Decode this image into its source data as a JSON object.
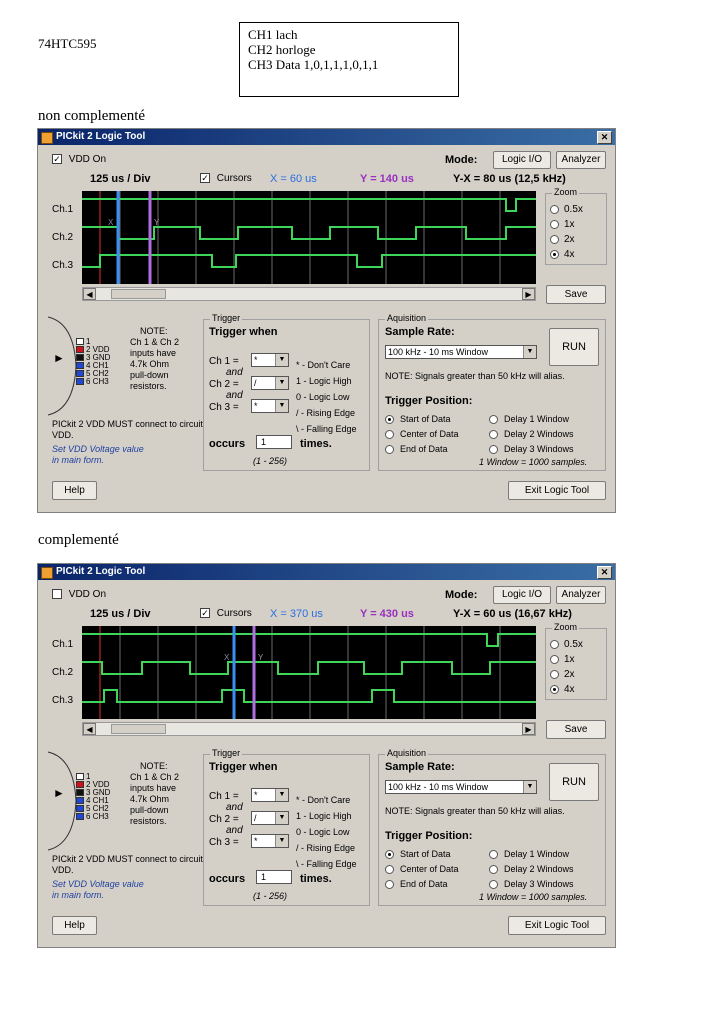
{
  "doc": {
    "ic_name": "74HTC595",
    "channels": [
      "CH1 lach",
      "CH2 horloge",
      "CH3 Data 1,0,1,1,1,0,1,1"
    ],
    "caption1": "non complementé",
    "caption2": "complementé"
  },
  "windows": [
    {
      "title": "PICkit 2 Logic Tool",
      "vdd_label": "VDD On",
      "vdd_checked": "✓",
      "mode_label": "Mode:",
      "mode_buttons": [
        "Logic I/O",
        "Analyzer"
      ],
      "time_div": "125 us / Div",
      "cursors_label": "Cursors",
      "cursors_checked": "✓",
      "x_readout": "X = 60 us",
      "y_readout": "Y = 140 us",
      "yx_readout": "Y-X = 80 us (12,5 kHz)",
      "channels": [
        "Ch.1",
        "Ch.2",
        "Ch.3"
      ],
      "zoom_title": "Zoom",
      "zoom_options": [
        "0.5x",
        "1x",
        "2x",
        "4x"
      ],
      "zoom_selected": "4x",
      "save_label": "Save",
      "pin_note": [
        "NOTE:",
        "Ch 1 & Ch 2",
        "inputs have",
        "4.7k Ohm",
        "pull-down",
        "resistors."
      ],
      "pins": [
        "1",
        "2 VDD",
        "3 GND",
        "4 CH1",
        "5 CH2",
        "6 CH3"
      ],
      "vdd_connect": "PICkit 2 VDD MUST connect to circuit VDD.",
      "vdd_set": [
        "Set VDD Voltage value",
        "in main form."
      ],
      "help_label": "Help",
      "trigger": {
        "group": "Trigger",
        "heading": "Trigger when",
        "ch1": "Ch 1 =",
        "ch2": "Ch 2 =",
        "ch3": "Ch 3 =",
        "and": "and",
        "ch1_val": "*",
        "ch2_val": "/",
        "ch3_val": "*",
        "legend": [
          "* - Don't Care",
          "1 - Logic High",
          "0 - Logic Low",
          "/ - Rising Edge",
          "\\ - Falling Edge"
        ],
        "occurs": "occurs",
        "occurs_val": "1",
        "times": "times.",
        "range": "(1 - 256)"
      },
      "acq": {
        "group": "Aquisition",
        "sample_rate": "Sample Rate:",
        "rate_val": "100 kHz - 10 ms Window",
        "run": "RUN",
        "alias_note": "NOTE: Signals greater than 50 kHz will alias.",
        "trig_pos": "Trigger Position:",
        "positions": [
          "Start of Data",
          "Center of Data",
          "End of Data",
          "Delay 1 Window",
          "Delay 2 Windows",
          "Delay 3 Windows"
        ],
        "position_selected": "Start of Data",
        "window_note": "1 Window = 1000 samples.",
        "exit": "Exit Logic Tool"
      }
    },
    {
      "title": "PICkit 2 Logic Tool",
      "vdd_label": "VDD On",
      "vdd_checked": "",
      "mode_label": "Mode:",
      "mode_buttons": [
        "Logic I/O",
        "Analyzer"
      ],
      "time_div": "125 us / Div",
      "cursors_label": "Cursors",
      "cursors_checked": "✓",
      "x_readout": "X = 370 us",
      "y_readout": "Y = 430 us",
      "yx_readout": "Y-X = 60 us (16,67 kHz)",
      "channels": [
        "Ch.1",
        "Ch.2",
        "Ch.3"
      ],
      "zoom_title": "Zoom",
      "zoom_options": [
        "0.5x",
        "1x",
        "2x",
        "4x"
      ],
      "zoom_selected": "4x",
      "save_label": "Save",
      "pin_note": [
        "NOTE:",
        "Ch 1 & Ch 2",
        "inputs have",
        "4.7k Ohm",
        "pull-down",
        "resistors."
      ],
      "pins": [
        "1",
        "2 VDD",
        "3 GND",
        "4 CH1",
        "5 CH2",
        "6 CH3"
      ],
      "vdd_connect": "PICkit 2 VDD MUST connect to circuit VDD.",
      "vdd_set": [
        "Set VDD Voltage value",
        "in main form."
      ],
      "help_label": "Help",
      "trigger": {
        "group": "Trigger",
        "heading": "Trigger when",
        "ch1": "Ch 1 =",
        "ch2": "Ch 2 =",
        "ch3": "Ch 3 =",
        "and": "and",
        "ch1_val": "*",
        "ch2_val": "/",
        "ch3_val": "*",
        "legend": [
          "* - Don't Care",
          "1 - Logic High",
          "0 - Logic Low",
          "/ - Rising Edge",
          "\\ - Falling Edge"
        ],
        "occurs": "occurs",
        "occurs_val": "1",
        "times": "times.",
        "range": "(1 - 256)"
      },
      "acq": {
        "group": "Aquisition",
        "sample_rate": "Sample Rate:",
        "rate_val": "100 kHz - 10 ms Window",
        "run": "RUN",
        "alias_note": "NOTE: Signals greater than 50 kHz will alias.",
        "trig_pos": "Trigger Position:",
        "positions": [
          "Start of Data",
          "Center of Data",
          "End of Data",
          "Delay 1 Window",
          "Delay 2 Windows",
          "Delay 3 Windows"
        ],
        "position_selected": "Start of Data",
        "window_note": "1 Window = 1000 samples.",
        "exit": "Exit Logic Tool"
      }
    }
  ],
  "colors": {
    "trace": "#3fd45a",
    "cursor_x": "#3a8ff0",
    "cursor_y": "#b070e0",
    "grid": "#6a6a6a"
  }
}
